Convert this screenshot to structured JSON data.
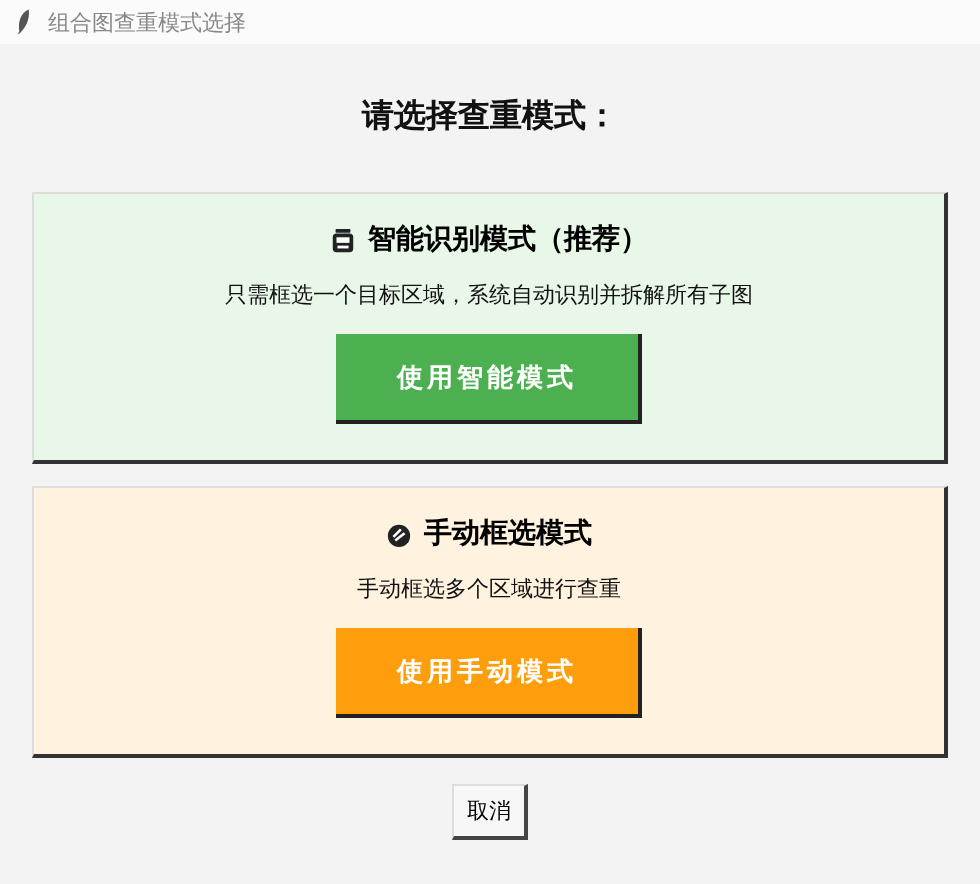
{
  "window": {
    "title": "组合图查重模式选择"
  },
  "heading": "请选择查重模式：",
  "modes": [
    {
      "kind": "smart",
      "title": "智能识别模式（推荐）",
      "description": "只需框选一个目标区域，系统自动识别并拆解所有子图",
      "button": "使用智能模式"
    },
    {
      "kind": "manual",
      "title": "手动框选模式",
      "description": "手动框选多个区域进行查重",
      "button": "使用手动模式"
    }
  ],
  "buttons": [
    "取消"
  ]
}
